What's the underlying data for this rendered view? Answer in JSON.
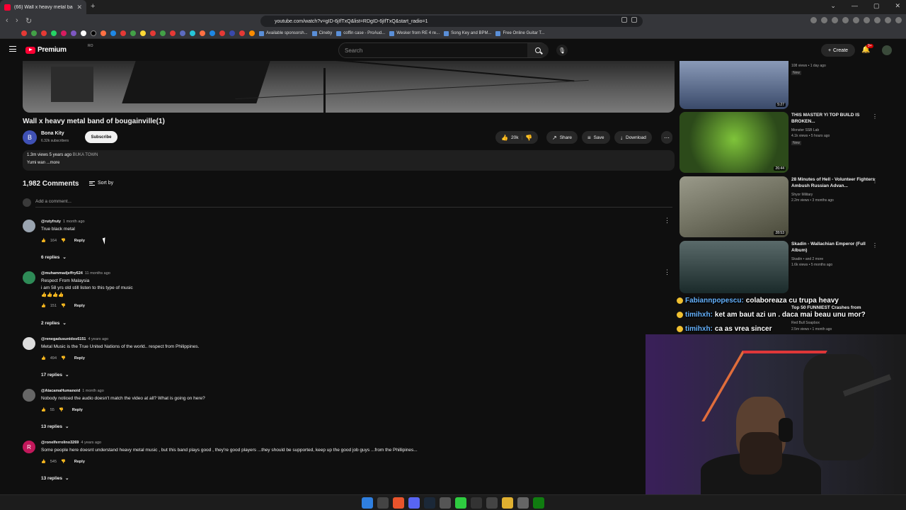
{
  "browser": {
    "tab_title": "(66) Wall x heavy metal band",
    "url": "youtube.com/watch?v=gID-6jIfTxQ&list=RDgID-6jIfTxQ&start_radio=1",
    "bookmarks": [
      "Available sponsorsh...",
      "Cineby",
      "coffin case - ProAud...",
      "Wesker from RE 4 re...",
      "Song Key and BPM...",
      "Free Online Guitar T..."
    ]
  },
  "header": {
    "logo_text": "Premium",
    "logo_sup": "RO",
    "search_placeholder": "Search",
    "create_label": "Create",
    "notif_badge": "9+"
  },
  "video": {
    "title": "Wall x heavy metal band of bougainville(1)",
    "channel": "Bona Kity",
    "channel_initial": "B",
    "subscribers": "6.32k subscribers",
    "subscribe_label": "Subscribe",
    "likes": "20k",
    "share_label": "Share",
    "save_label": "Save",
    "download_label": "Download",
    "views_time": "1.3m views  5 years ago",
    "tag": "BUKA TOWN",
    "desc": "Yumi wan ...more"
  },
  "comments": {
    "count": "1,982 Comments",
    "sort_label": "Sort by",
    "add_placeholder": "Add a comment...",
    "items": [
      {
        "author": "@rutyfruty",
        "time": "1 month ago",
        "text": "True black metal",
        "text2": "",
        "likes": "164",
        "replies": "6 replies",
        "reply_label": "Reply",
        "avatar_color": "#9aa4b0"
      },
      {
        "author": "@muhammadjeffry624",
        "time": "11 months ago",
        "text": "Respect From Malaysia",
        "text2": "i am 58 yrs old still listen to this type of music",
        "text3": "👍👍👍👍",
        "likes": "151",
        "replies": "2 replies",
        "reply_label": "Reply",
        "avatar_color": "#2e8b57"
      },
      {
        "author": "@renegadusunidos6151",
        "time": "4 years ago",
        "text": "Metal Music is the True United Nations of the world.. respect from Philippines.",
        "text2": "",
        "likes": "494",
        "replies": "17 replies",
        "reply_label": "Reply",
        "avatar_color": "#dddddd"
      },
      {
        "author": "@AtacamaHumanoid",
        "time": "1 month ago",
        "text": "Nobody noticed the audio doesn't match the video at all? What is going on here?",
        "text2": "",
        "likes": "55",
        "replies": "13 replies",
        "reply_label": "Reply",
        "avatar_color": "#666666"
      },
      {
        "author": "@ronelferrolino3269",
        "time": "4 years ago",
        "text": "Some people here doesnt understand heavy metal music , but this band plays good , they're good players ...they should be supported, keep up the good job guys ...from the Phillipines...",
        "text2": "",
        "likes": "545",
        "replies": "13 replies",
        "reply_label": "Reply",
        "avatar_color": "#c2185b",
        "initial": "R"
      }
    ]
  },
  "sidebar": {
    "items": [
      {
        "title": "",
        "channel": "",
        "meta": "108 views • 1 day ago",
        "badge": "New",
        "duration": "5:27",
        "thumb": "#6a7a9a"
      },
      {
        "title": "THIS MASTER YI TOP BUILD IS BROKEN...",
        "channel": "Monster SSB Lab",
        "meta": "4.1k views • 5 hours ago",
        "badge": "New",
        "duration": "26:44",
        "thumb": "#3f6e2a"
      },
      {
        "title": "28 Minutes of Hell - Volunteer Fighters Ambush Russian Advan...",
        "channel": "Shyor Military",
        "meta": "2.2m views • 3 months ago",
        "badge": "",
        "duration": "28:53",
        "thumb": "#6b6a5a"
      },
      {
        "title": "Skadin - Wallachian Emperor (Full Album)",
        "channel": "Skadin • and 2 more",
        "meta": "1.6k views • 5 months ago",
        "badge": "",
        "duration": "",
        "thumb": "#3a4a4a"
      },
      {
        "title": "Top 50 FUNNIEST Crashes from",
        "channel": "Red Bull Soapbox",
        "meta": "2.5m views • 1 month ago",
        "badge": "",
        "duration": "",
        "thumb": "#2a2a2a"
      }
    ]
  },
  "chat": [
    {
      "name": "Fabiannpopescu:",
      "msg": "colaboreaza cu trupa heavy"
    },
    {
      "name": "timihxh:",
      "msg": "ket am baut azi un . daca mai beau unu mor?"
    },
    {
      "name": "timihxh:",
      "msg": "ca as vrea sincer"
    }
  ]
}
